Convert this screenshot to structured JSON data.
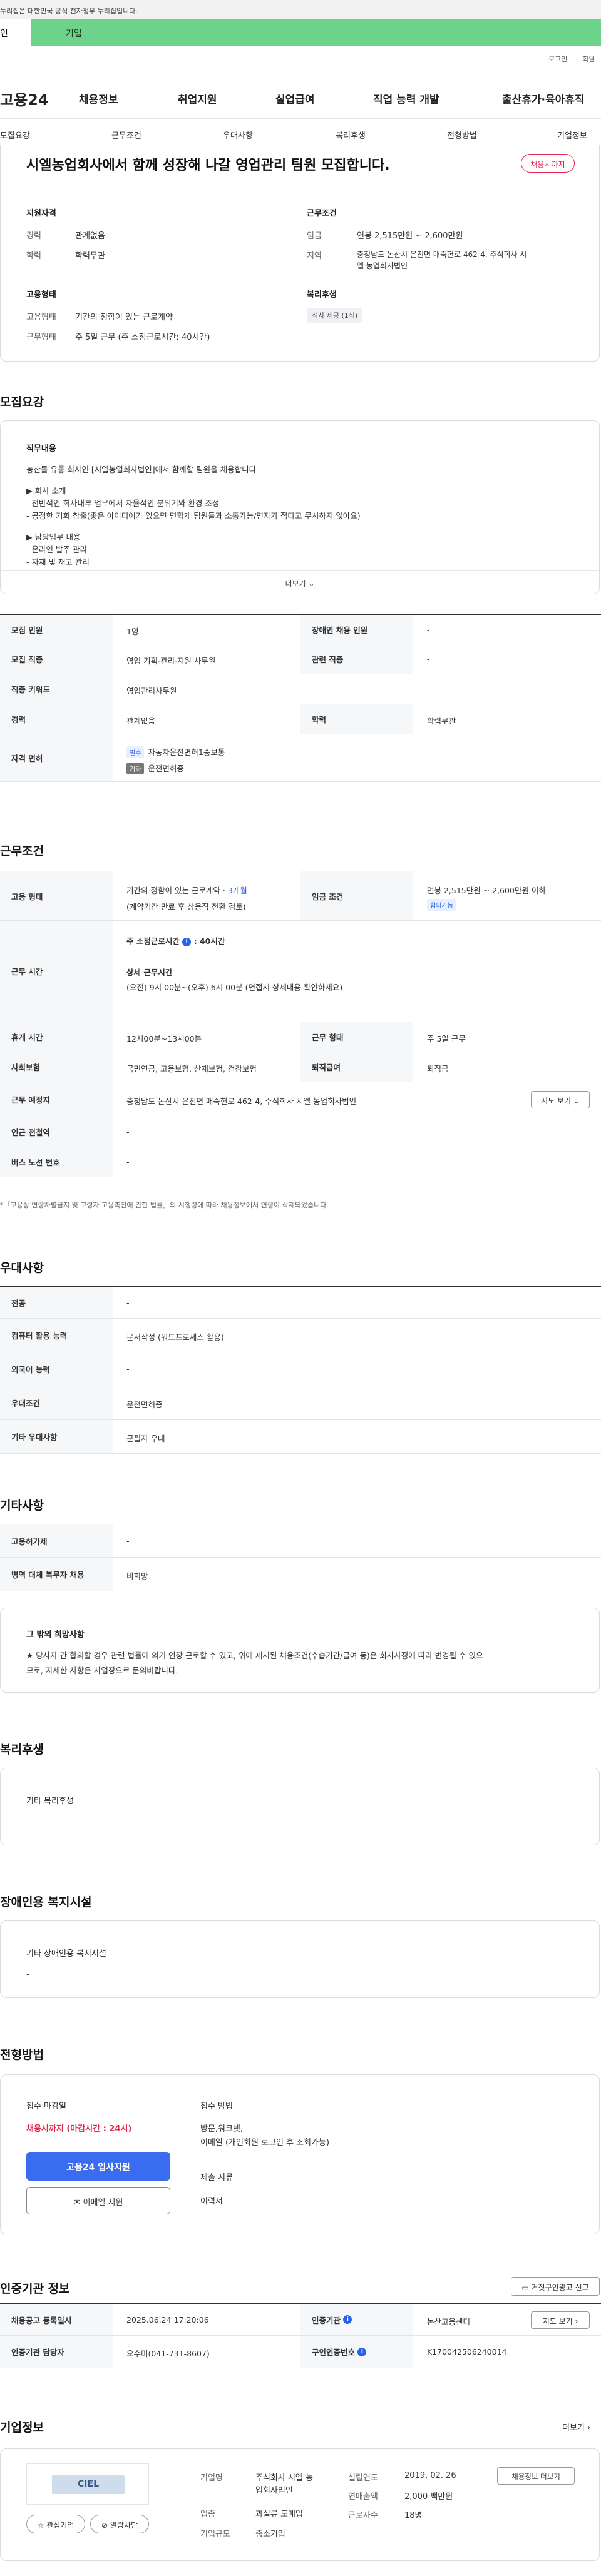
{
  "top_notice": "누리집은 대한민국 공식 전자정부 누리집입니다.",
  "top_tabs": {
    "person": "인",
    "business": "기업"
  },
  "util_links": {
    "login": "로그인",
    "join": "회원"
  },
  "logo": "고용24",
  "gnb": [
    "채용정보",
    "취업지원",
    "실업급여",
    "직업 능력 개발",
    "출산휴가·육아휴직"
  ],
  "subnav": [
    "모집요강",
    "근무조건",
    "우대사항",
    "복리후생",
    "전형방법",
    "기업정보"
  ],
  "header": {
    "title": "시엘농업회사에서 함께 성장해 나갈 영업관리 팀원 모집합니다.",
    "badge": "채용시까지",
    "qual_title": "지원자격",
    "qual": [
      {
        "k": "경력",
        "v": "관계없음"
      },
      {
        "k": "학력",
        "v": "학력무관"
      }
    ],
    "cond_title": "근무조건",
    "cond": [
      {
        "k": "임금",
        "v": "연봉 2,515만원 ~ 2,600만원"
      },
      {
        "k": "지역",
        "v": "충청남도 논산시 은진면 매죽헌로 462-4, 주식회사 시",
        "v2": "엘 농업회사법인"
      }
    ],
    "emp_title": "고용형태",
    "emp": [
      {
        "k": "고용형태",
        "v": "기간의 정함이 있는 근로계약"
      },
      {
        "k": "근무형태",
        "v": "주 5일 근무 (주 소정근로시간: 40시간)"
      }
    ],
    "welfare_title": "복리후생",
    "welfare_chip": "식사 제공 (1식)"
  },
  "recruit": {
    "title": "모집요강",
    "desc_title": "직무내용",
    "desc_lines": [
      "농산물 유통 회사인 [시엘농업회사법인]에서 함께할 팀원을 채용합니다",
      "▶ 회사 소개",
      "- 전반적인 회사내부 업무에서 자율적인 분위기와 환경 조성",
      "- 공정한 기회 창출(좋은 아이디어가 있으면 면학게 팀원들과 소통가능/면자가 적다고 무시하지 않아요)",
      "▶ 담당업무 내용",
      "- 온라인 발주 관리",
      "- 자재 및 재고 관리"
    ],
    "more": "더보기",
    "rows": [
      {
        "k1": "모집 인원",
        "v1": "1명",
        "k2": "장애인 채용 인원",
        "v2": "-"
      },
      {
        "k1": "모집 직종",
        "v1": "영업 기획·관리·지원 사무원",
        "k2": "관련 직종",
        "v2": "-"
      },
      {
        "k1": "직종 키워드",
        "v1": "영업관리사무원"
      },
      {
        "k1": "경력",
        "v1": "관계없음",
        "k2": "학력",
        "v2": "학력무관"
      }
    ],
    "license_k": "자격 면허",
    "license": [
      {
        "tag": "필수",
        "v": "자동차운전면허1종보통"
      },
      {
        "tag": "기타",
        "v": "운전면허증"
      }
    ]
  },
  "work": {
    "title": "근무조건",
    "emp_k": "고용 형태",
    "emp_v1": "기간의 정함이 있는 근로계약 · ",
    "emp_v1b": "3개월",
    "emp_v2": "(계약기간 만료 후 상용직 전환 검토)",
    "wage_k": "임금 조건",
    "wage_v": "연봉 2,515만원 ~ 2,600만원 이하",
    "wage_tag": "협의가능",
    "time_k": "근무 시간",
    "time_t1": "주 소정근로시간",
    "time_t1v": ": 40시간",
    "time_t2": "상세 근무시간",
    "time_t2v": "(오전) 9시 00분~(오후) 6시 00분 (면접시 상세내용 확인하세요)",
    "rows": [
      {
        "k1": "휴게 시간",
        "v1": "12시00분~13시00분",
        "k2": "근무 형태",
        "v2": "주 5일 근무"
      },
      {
        "k1": "사회보험",
        "v1": "국민연금, 고용보험, 산재보험, 건강보험",
        "k2": "퇴직급여",
        "v2": "퇴직금"
      },
      {
        "k1": "근무 예정지",
        "v1": "충청남도 논산시 은진면 매죽헌로 462-4, 주식회사 시엘 농업회사법인",
        "btn": "지도 보기"
      },
      {
        "k1": "인근 전철역",
        "v1": "-"
      },
      {
        "k1": "버스 노선 번호",
        "v1": "-"
      }
    ],
    "note": "*「고용상 연령차별금지 및 고령자 고용촉진에 관한 법률」의 시행령에 따라 채용정보에서 연령이 삭제되었습니다."
  },
  "prefer": {
    "title": "우대사항",
    "rows": [
      {
        "k": "전공",
        "v": "-"
      },
      {
        "k": "컴퓨터 활용 능력",
        "v": "문서작성 (워드프로세스 활용)"
      },
      {
        "k": "외국어 능력",
        "v": "-"
      },
      {
        "k": "우대조건",
        "v": "운전면허증"
      },
      {
        "k": "기타 우대사항",
        "v": "군필자 우대"
      }
    ]
  },
  "etc": {
    "title": "기타사항",
    "rows": [
      {
        "k": "고용허가제",
        "v": "-"
      },
      {
        "k": "병역 대체 복무자 채용",
        "v": "비희망"
      }
    ],
    "box_title": "그 밖의 희망사항",
    "box_line1": "★ 당사자 간 합의할 경우 관련 법률에 의거 연장 근로할 수 있고, 위에 제시된 채용조건(수습기간/급여 등)은 회사사정에 따라 변경될 수 있으",
    "box_line2": "므로, 자세한 사항은 사업장으로 문의바랍니다."
  },
  "welfare": {
    "title": "복리후생",
    "box_title": "기타 복리후생",
    "box_v": "-"
  },
  "disabled": {
    "title": "장애인용 복지시설",
    "box_title": "기타 장애인용 복지시설",
    "box_v": "-"
  },
  "process": {
    "title": "전형방법",
    "deadline_title": "접수 마감일",
    "deadline_v": "채용시까지 (마감시간 : 24시)",
    "apply_btn": "고용24 입사지원",
    "email_btn": "이메일 지원",
    "method_title": "접수 방법",
    "method_v1": "방문,워크넷,",
    "method_v2": "이메일 (개인회원 로그인 후 조회가능)",
    "docs_title": "제출 서류",
    "docs_v": "이력서"
  },
  "cert": {
    "title": "인증기관 정보",
    "btn": "거짓구인광고 신고",
    "rows": [
      {
        "k1": "채용공고 등록일시",
        "v1": "2025.06.24 17:20:06",
        "k2": "인증기관",
        "v2": "논산고용센터",
        "btn": "지도 보기"
      },
      {
        "k1": "인증기관 담당자",
        "v1": "오수미(041-731-8607)",
        "k2": "구인인증번호",
        "v2": "K170042506240014"
      }
    ]
  },
  "company": {
    "title": "기업정보",
    "more": "더보기",
    "logo_text": "CIEL",
    "like_btn": "관심기업",
    "block_btn": "열람차단",
    "info_btn": "채용정보 더보기",
    "fields": [
      {
        "k": "기업명",
        "v": "주식회사 시엘 농",
        "v2": "업회사법인"
      },
      {
        "k": "업종",
        "v": "과실류 도매업"
      },
      {
        "k": "기업규모",
        "v": "중소기업"
      }
    ],
    "fields2": [
      {
        "k": "설립연도",
        "v": "2019. 02. 26"
      },
      {
        "k": "연매출액",
        "v": "2,000 백만원"
      },
      {
        "k": "근로자수",
        "v": "18명"
      }
    ]
  }
}
